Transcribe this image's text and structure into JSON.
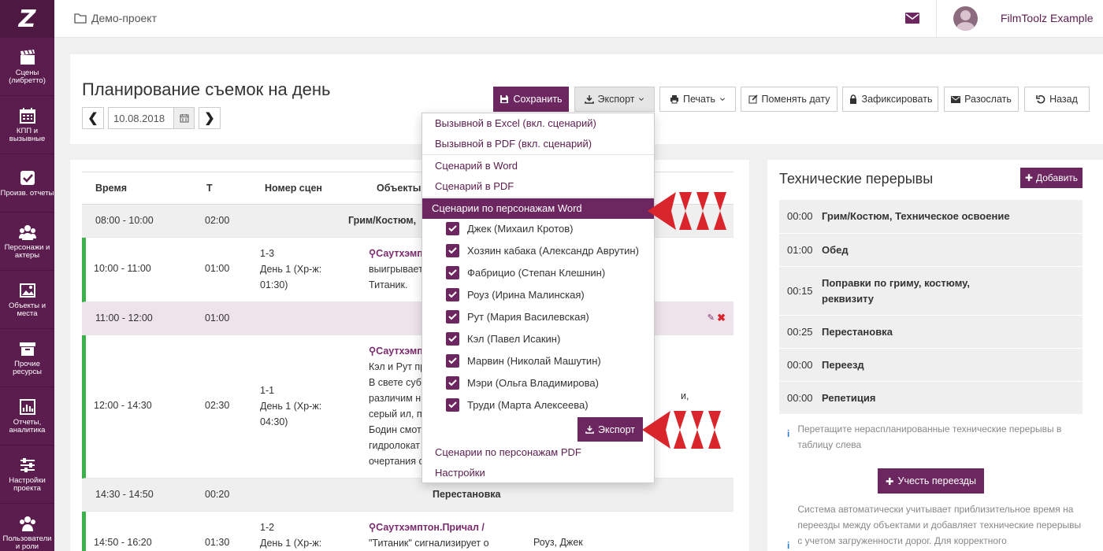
{
  "colors": {
    "brand": "#5b1d4e",
    "accent": "#6d2760",
    "green": "#3cb14a",
    "red": "#d9262c"
  },
  "sidebar": {
    "logo": "Z",
    "items": [
      {
        "icon": "clapperboard-icon",
        "label": "Сцены (либретто)"
      },
      {
        "icon": "calendar-icon",
        "label": "КПП и вызывные"
      },
      {
        "icon": "checkbox-icon",
        "label": "Произв. отчеты"
      },
      {
        "icon": "people-icon",
        "label": "Персонажи и актеры"
      },
      {
        "icon": "image-icon",
        "label": "Объекты и места"
      },
      {
        "icon": "archive-icon",
        "label": "Прочие ресурсы"
      },
      {
        "icon": "bar-chart-icon",
        "label": "Отчеты, аналитика"
      },
      {
        "icon": "sliders-icon",
        "label": "Настройки проекта"
      },
      {
        "icon": "users-icon",
        "label": "Пользователи и роли"
      }
    ]
  },
  "topbar": {
    "project": "Демо-проект",
    "user": "FilmToolz Example"
  },
  "header": {
    "title": "Планирование съемок на день",
    "date": "10.08.2018",
    "prev": "❮",
    "next": "❯"
  },
  "toolbar": {
    "save": "Сохранить",
    "export": "Экспорт",
    "print": "Печать",
    "change_date": "Поменять дату",
    "lock": "Зафиксировать",
    "send": "Разослать",
    "back": "Назад"
  },
  "table": {
    "headers": {
      "time": "Время",
      "t": "Т",
      "scene": "Номер сцен",
      "objects": "Объекты"
    },
    "rows": [
      {
        "time": "08:00 - 10:00",
        "t": "02:00",
        "title": "Грим/Костюм, "
      },
      {
        "time": "10:00 - 11:00",
        "t": "01:00",
        "scene": [
          "1-3",
          "День 1 (Хр-ж:",
          "01:30)"
        ],
        "place": "Саутхэмпт",
        "text": [
          "выигрывает",
          "Титаник."
        ]
      },
      {
        "time": "11:00 - 12:00",
        "t": "01:00"
      },
      {
        "time": "12:00 - 14:30",
        "t": "02:30",
        "scene": [
          "1-1",
          "День 1 (Хр-ж:",
          "04:30)"
        ],
        "place": "Саутхэмпт",
        "text": [
          "Кэл и Рут пр",
          "В свете субб",
          "различим н",
          "серый ил, п",
          "Бодин смот",
          "гидролокат",
          "очертания с"
        ],
        "extra": "и,"
      },
      {
        "time": "14:30 - 14:50",
        "t": "00:20",
        "title": "Перестановка"
      },
      {
        "time": "14:50 - 16:20",
        "t": "01:30",
        "scene": [
          "1-2",
          "День 1 (Хр-ж:"
        ],
        "place": "Саутхэмптон.Причал /",
        "text": [
          "\"Титаник\" сигнализирует о"
        ],
        "cast": "Роуз, Джек"
      }
    ]
  },
  "export_menu": {
    "call_excel": "Вызывной в Excel (вкл. сценарий)",
    "call_pdf": "Вызывной в PDF (вкл. сценарий)",
    "script_word": "Сценарий в Word",
    "script_pdf": "Сценарий в PDF",
    "by_char_word": "Сценарии по персонажам Word",
    "characters": [
      "Джек (Михаил Кротов)",
      "Хозяин кабака (Александр Аврутин)",
      "Фабрицио (Степан Клешнин)",
      "Роуз (Ирина Малинская)",
      "Рут (Мария Василевская)",
      "Кэл (Павел Исакин)",
      "Марвин (Николай Машутин)",
      "Мэри (Ольга Владимирова)",
      "Труди (Марта Алексеева)"
    ],
    "export_btn": "Экспорт",
    "by_char_pdf": "Сценарии по персонажам PDF",
    "settings": "Настройки"
  },
  "breaks": {
    "title": "Технические перерывы",
    "add": "Добавить",
    "items": [
      {
        "t": "00:00",
        "name": "Грим/Костюм, Техническое освоение"
      },
      {
        "t": "01:00",
        "name": "Обед"
      },
      {
        "t": "00:15",
        "name": "Поправки по гриму, костюму, реквизиту"
      },
      {
        "t": "00:25",
        "name": "Перестановка"
      },
      {
        "t": "00:00",
        "name": "Переезд"
      },
      {
        "t": "00:00",
        "name": "Репетиция"
      }
    ],
    "hint": "Перетащите нераспланированные технические перерывы в таблицу слева",
    "moves_btn": "Учесть переезды",
    "auto_note": "Система автоматически учитывает приблизительное время на переезды между объектами и добавляет технические перерывы с учетом загруженности дорог. Для корректного"
  }
}
